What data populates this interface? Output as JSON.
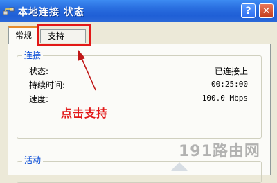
{
  "window": {
    "title": "本地连接 状态",
    "help_label": "?",
    "close_label": "✕"
  },
  "tabs": [
    {
      "label": "常规",
      "active": true
    },
    {
      "label": "支持",
      "active": false
    }
  ],
  "connection": {
    "group_label": "连接",
    "rows": [
      {
        "label": "状态:",
        "value": "已连接上"
      },
      {
        "label": "持续时间:",
        "value": "00:25:00"
      },
      {
        "label": "速度:",
        "value": "100.0 Mbps"
      }
    ]
  },
  "activity": {
    "group_label": "活动"
  },
  "annotation": {
    "text": "点击支持"
  },
  "watermark": {
    "text": "191路由网"
  },
  "colors": {
    "title_bar": "#2a6fe0",
    "highlight": "#e21818",
    "group_label": "#0046d5"
  },
  "icons": [
    "network-connection-icon",
    "help-icon",
    "close-icon",
    "arrow-icon"
  ]
}
